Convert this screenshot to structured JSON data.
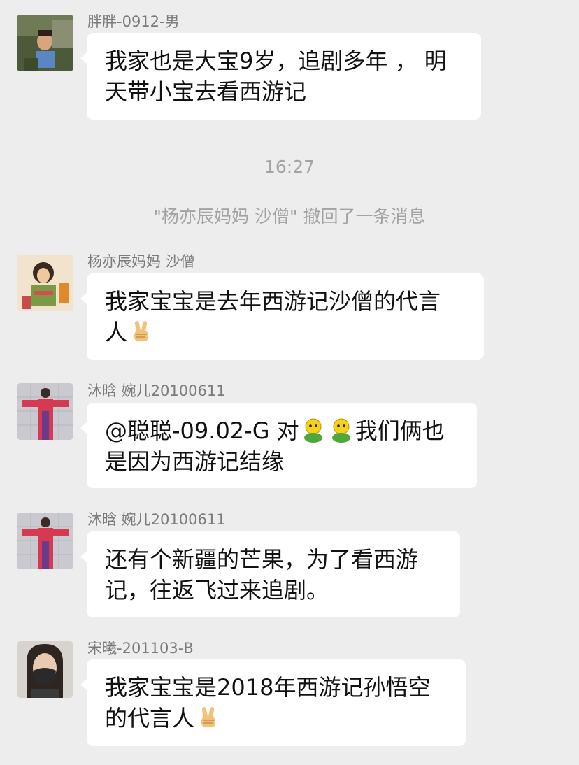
{
  "chat": {
    "messages": [
      {
        "sender": "胖胖-0912-男",
        "lines": [
          "我家也是大宝9岁，追剧多年 ， 明",
          "天带小宝去看西游记"
        ]
      },
      {
        "sender": "杨亦辰妈妈 沙僧",
        "lines": [
          "我家宝宝是去年西游记沙僧的代言",
          "人"
        ]
      },
      {
        "sender": "沐晗 婉儿20100611",
        "line1_part1": "@聪聪-09.02-G 对",
        "line1_part2": "我们俩也",
        "line2": "是因为西游记结缘"
      },
      {
        "sender": "沐晗 婉儿20100611",
        "lines": [
          "还有个新疆的芒果，为了看西游",
          "记，往返飞过来追剧。"
        ]
      },
      {
        "sender": "宋曦-201103-B",
        "lines": [
          "我家宝宝是2018年西游记孙悟空",
          "的代言人"
        ]
      }
    ],
    "timestamp": "16:27",
    "recall_notice": "\"杨亦辰妈妈 沙僧\" 撤回了一条消息",
    "icons": {
      "victory": "victory-hand-icon",
      "emoji": "smiley-face-emoji-icon"
    }
  }
}
